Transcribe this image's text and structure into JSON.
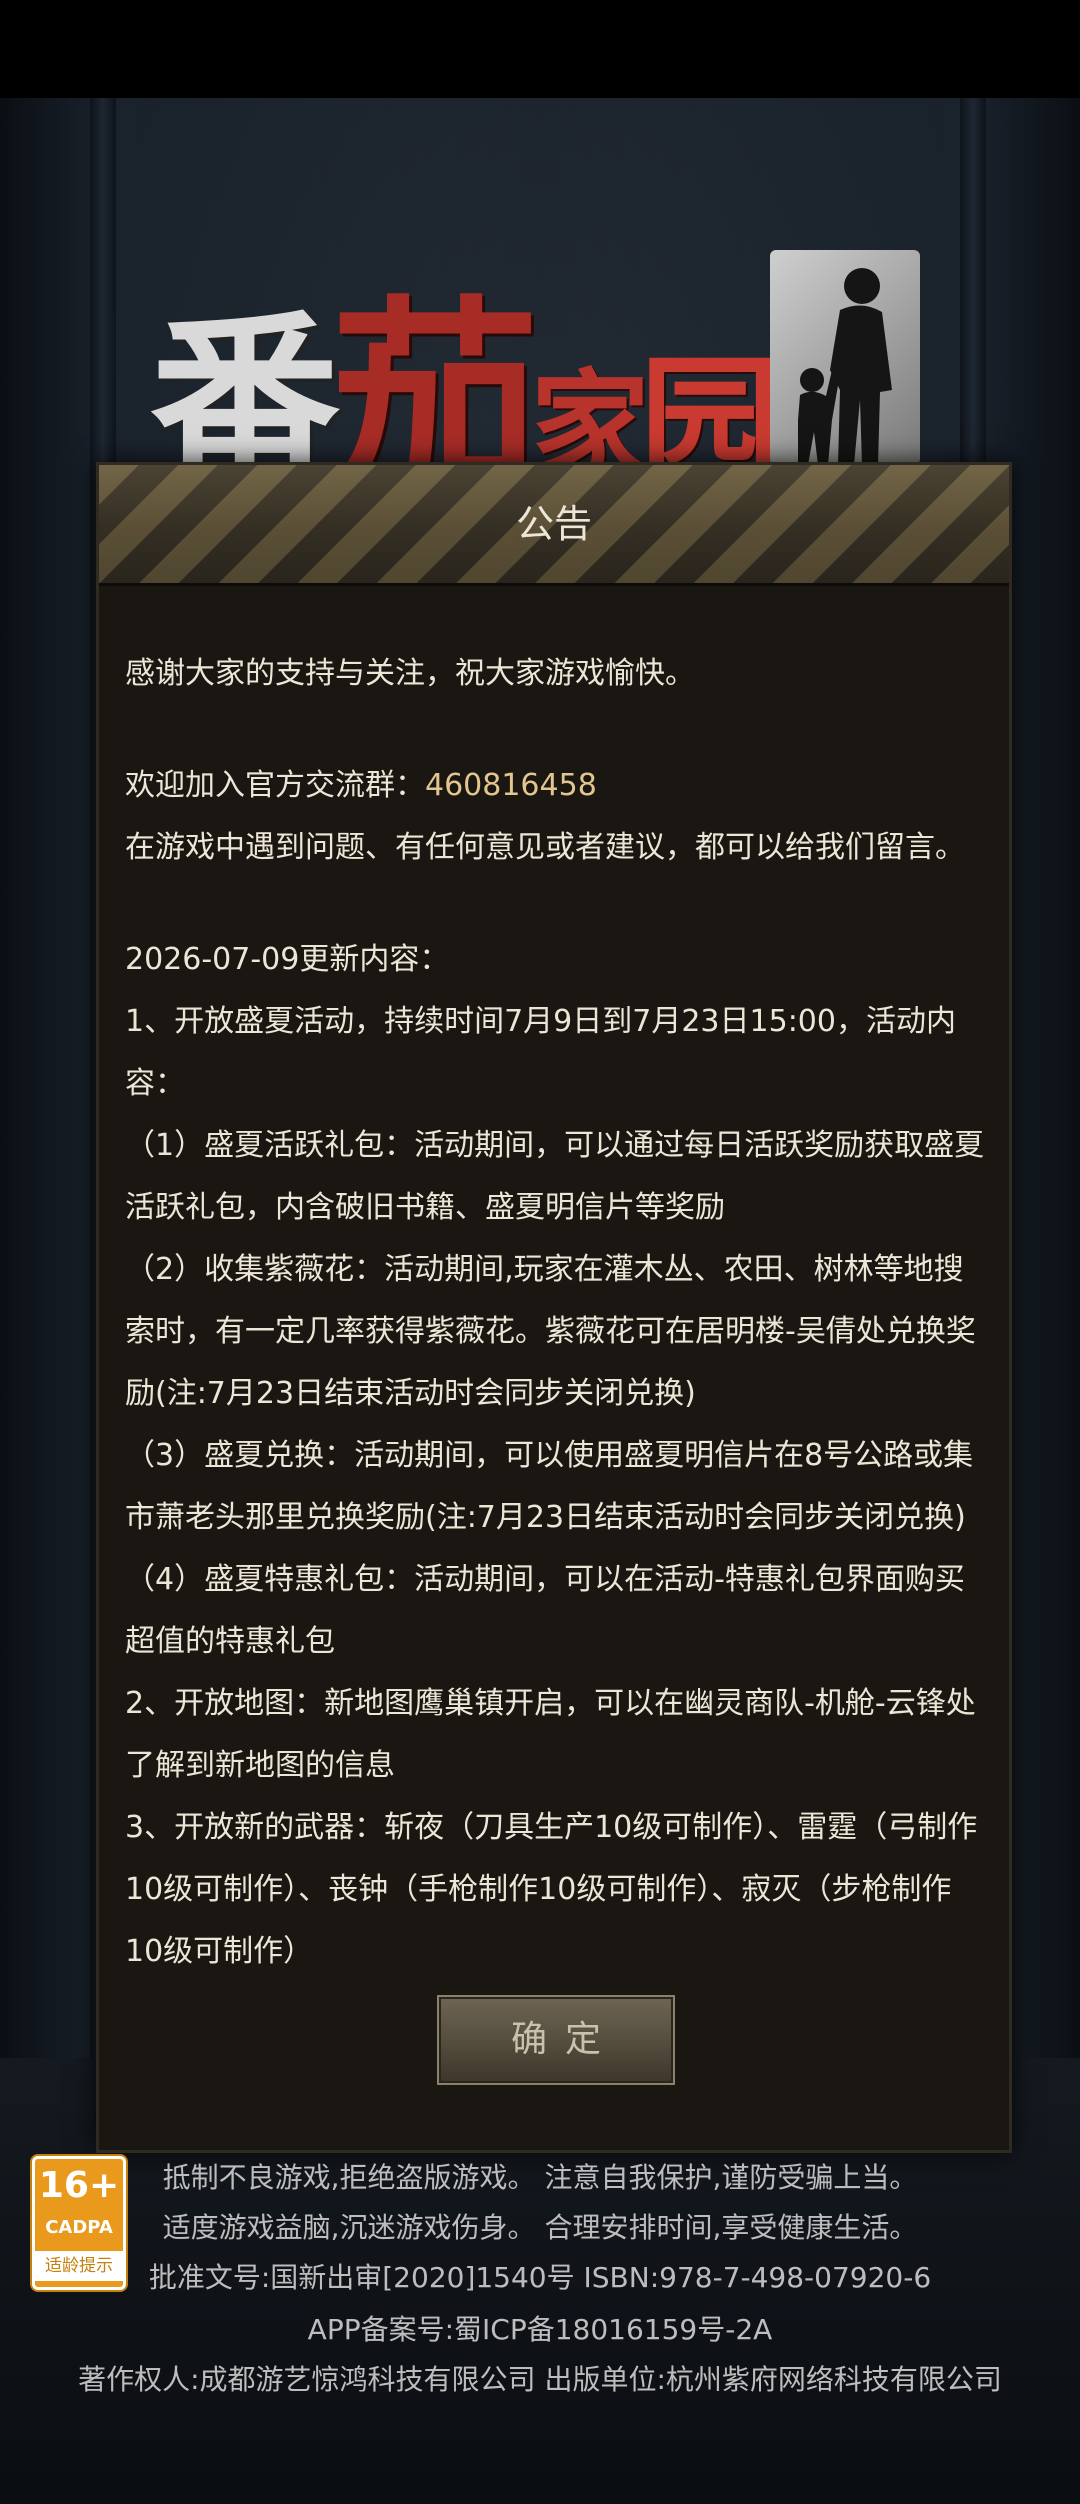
{
  "logo": {
    "title": "番茄家园",
    "w1": "番",
    "w2": "茄",
    "w3": "家",
    "w4": "园"
  },
  "dialog": {
    "title": "公告",
    "line1": "感谢大家的支持与关注，祝大家游戏愉快。",
    "qq_prefix": "欢迎加入官方交流群：",
    "qq_number": "460816458",
    "feedback": "在游戏中遇到问题、有任何意见或者建议，都可以给我们留言。",
    "update_header": "2026-07-09更新内容：",
    "item1": "1、开放盛夏活动，持续时间7月9日到7月23日15:00，活动内容：",
    "item1_1": "（1）盛夏活跃礼包：活动期间，可以通过每日活跃奖励获取盛夏活跃礼包，内含破旧书籍、盛夏明信片等奖励",
    "item1_2": "（2）收集紫薇花：活动期间,玩家在灌木丛、农田、树林等地搜索时，有一定几率获得紫薇花。紫薇花可在居明楼-吴倩处兑换奖励(注:7月23日结束活动时会同步关闭兑换)",
    "item1_3": "（3）盛夏兑换：活动期间，可以使用盛夏明信片在8号公路或集市萧老头那里兑换奖励(注:7月23日结束活动时会同步关闭兑换)",
    "item1_4": "（4）盛夏特惠礼包：活动期间，可以在活动-特惠礼包界面购买超值的特惠礼包",
    "item2": "2、开放地图：新地图鹰巢镇开启，可以在幽灵商队-机舱-云锋处了解到新地图的信息",
    "item3": "3、开放新的武器：斩夜（刀具生产10级可制作）、雷霆（弓制作10级可制作）、丧钟（手枪制作10级可制作）、寂灭（步枪制作10级可制作）",
    "confirm_label": "确定"
  },
  "footer": {
    "line1": "抵制不良游戏,拒绝盗版游戏。 注意自我保护,谨防受骗上当。",
    "line2": "适度游戏益脑,沉迷游戏伤身。 合理安排时间,享受健康生活。",
    "line3": "批准文号:国新出审[2020]1540号    ISBN:978-7-498-07920-6",
    "line4": "APP备案号:蜀ICP备18016159号-2A",
    "line5": "著作权人:成都游艺惊鸿科技有限公司 出版单位:杭州紫府网络科技有限公司",
    "rating_age": "16+",
    "rating_org": "CADPA",
    "rating_tip": "适龄提示"
  },
  "colors": {
    "accent": "#e2c58f",
    "text": "#ece6d6",
    "rating": "#e99a1c"
  }
}
